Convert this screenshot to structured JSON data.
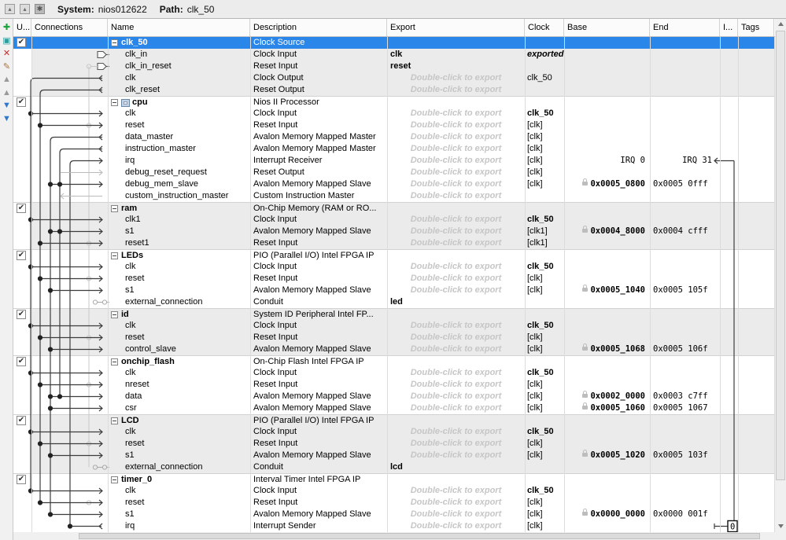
{
  "titlebar": {
    "system_label": "System:",
    "system_value": "nios012622",
    "path_label": "Path:",
    "path_value": "clk_50",
    "icons": [
      {
        "name": "dock-window-icon",
        "glyph": "▴"
      },
      {
        "name": "float-window-icon",
        "glyph": "▴"
      },
      {
        "name": "settings-icon",
        "glyph": "✱"
      }
    ]
  },
  "left_toolbar": {
    "icons": [
      {
        "name": "add-component-icon",
        "glyph": "✚",
        "color": "#1fa33c"
      },
      {
        "name": "duplicate-icon",
        "glyph": "▣",
        "color": "#2e9e9e"
      },
      {
        "name": "remove-icon",
        "glyph": "✕",
        "color": "#cc2a2a"
      },
      {
        "name": "edit-icon",
        "glyph": "✎",
        "color": "#a8763e"
      },
      {
        "name": "move-top-icon",
        "glyph": "▲",
        "color": "#9a9a9a"
      },
      {
        "name": "move-up-icon",
        "glyph": "▲",
        "color": "#9a9a9a"
      },
      {
        "name": "move-down-icon",
        "glyph": "▼",
        "color": "#3277cc"
      },
      {
        "name": "move-bottom-icon",
        "glyph": "▼",
        "color": "#3277cc"
      }
    ]
  },
  "colors": {
    "selection_blue": "#2a86e8",
    "group_shade": "#ebebeb",
    "placeholder_gray": "#c6c6c6",
    "wire_dark": "#3c3c3c",
    "wire_light": "#c8c8c8"
  },
  "table": {
    "columns": [
      {
        "id": "use",
        "label": "U..."
      },
      {
        "id": "connections",
        "label": "Connections"
      },
      {
        "id": "name",
        "label": "Name"
      },
      {
        "id": "description",
        "label": "Description"
      },
      {
        "id": "export",
        "label": "Export"
      },
      {
        "id": "clock",
        "label": "Clock"
      },
      {
        "id": "base",
        "label": "Base"
      },
      {
        "id": "end",
        "label": "End"
      },
      {
        "id": "irq",
        "label": "I..."
      },
      {
        "id": "tags",
        "label": "Tags"
      }
    ],
    "export_placeholder": "Double-click to export",
    "irq_labels": {
      "start": "IRQ 0",
      "end": "IRQ 31",
      "timer_irq_number": "0"
    },
    "rows": [
      {
        "name": "clk_50",
        "desc": "Clock Source",
        "group": true,
        "selected": true,
        "checkbox": true,
        "shade": "g"
      },
      {
        "name": "clk_in",
        "desc": "Clock Input",
        "shade": "g",
        "export": "clk",
        "clock": "exported",
        "clockStyle": "e",
        "conn": {
          "end": "port"
        }
      },
      {
        "name": "clk_in_reset",
        "desc": "Reset Input",
        "shade": "g",
        "export": "reset",
        "conn": {
          "end": "port",
          "lightCircle": true
        }
      },
      {
        "name": "clk",
        "desc": "Clock Output",
        "shade": "g",
        "ph": true,
        "clock": "clk_50",
        "clockStyle": "p",
        "conn": {
          "curve": 1,
          "end": "out"
        }
      },
      {
        "name": "clk_reset",
        "desc": "Reset Output",
        "shade": "g",
        "ph": true,
        "conn": {
          "curve": 2,
          "end": "out"
        }
      },
      {
        "name": "cpu",
        "desc": "Nios II Processor",
        "group": true,
        "checkbox": true,
        "icon": "cpu-chip",
        "shade": "w"
      },
      {
        "name": "clk",
        "desc": "Clock Input",
        "shade": "w",
        "ph": true,
        "clock": "clk_50",
        "clockStyle": "b",
        "conn": {
          "dots": [
            1
          ],
          "end": "in"
        }
      },
      {
        "name": "reset",
        "desc": "Reset Input",
        "shade": "w",
        "ph": true,
        "clock": "[clk]",
        "conn": {
          "dots": [
            2
          ],
          "end": "in",
          "lightCircle": true
        }
      },
      {
        "name": "data_master",
        "desc": "Avalon Memory Mapped Master",
        "shade": "w",
        "ph": true,
        "clock": "[clk]",
        "conn": {
          "curve": 3,
          "end": "out"
        }
      },
      {
        "name": "instruction_master",
        "desc": "Avalon Memory Mapped Master",
        "shade": "w",
        "ph": true,
        "clock": "[clk]",
        "conn": {
          "curve": 4,
          "end": "out"
        }
      },
      {
        "name": "irq",
        "desc": "Interrupt Receiver",
        "shade": "w",
        "ph": true,
        "clock": "[clk]",
        "base": "IRQ 0",
        "end": "IRQ 31",
        "endRight": true,
        "irqArrow": true,
        "conn": {
          "curve": 5,
          "end": "in"
        }
      },
      {
        "name": "debug_reset_request",
        "desc": "Reset Output",
        "shade": "w",
        "ph": true,
        "clock": "[clk]",
        "conn": {
          "end": "gray-in"
        }
      },
      {
        "name": "debug_mem_slave",
        "desc": "Avalon Memory Mapped Slave",
        "shade": "w",
        "ph": true,
        "clock": "[clk]",
        "base": "0x0005_0800",
        "lock": true,
        "end": "0x0005 0fff",
        "conn": {
          "dots": [
            3,
            4
          ],
          "end": "in"
        }
      },
      {
        "name": "custom_instruction_master",
        "desc": "Custom Instruction Master",
        "shade": "w",
        "ph": true,
        "conn": {
          "end": "gray-out"
        }
      },
      {
        "name": "ram",
        "desc": "On-Chip Memory (RAM or RO...",
        "group": true,
        "checkbox": true,
        "shade": "g"
      },
      {
        "name": "clk1",
        "desc": "Clock Input",
        "shade": "g",
        "ph": true,
        "clock": "clk_50",
        "clockStyle": "b",
        "conn": {
          "dots": [
            1
          ],
          "end": "in"
        }
      },
      {
        "name": "s1",
        "desc": "Avalon Memory Mapped Slave",
        "shade": "g",
        "ph": true,
        "clock": "[clk1]",
        "base": "0x0004_8000",
        "lock": true,
        "end": "0x0004 cfff",
        "conn": {
          "dots": [
            3,
            4
          ],
          "end": "in"
        }
      },
      {
        "name": "reset1",
        "desc": "Reset Input",
        "shade": "g",
        "ph": true,
        "clock": "[clk1]",
        "conn": {
          "dots": [
            2
          ],
          "end": "in",
          "lightCircle": true
        }
      },
      {
        "name": "LEDs",
        "desc": "PIO (Parallel I/O) Intel FPGA IP",
        "group": true,
        "checkbox": true,
        "shade": "w"
      },
      {
        "name": "clk",
        "desc": "Clock Input",
        "shade": "w",
        "ph": true,
        "clock": "clk_50",
        "clockStyle": "b",
        "conn": {
          "dots": [
            1
          ],
          "end": "in"
        }
      },
      {
        "name": "reset",
        "desc": "Reset Input",
        "shade": "w",
        "ph": true,
        "clock": "[clk]",
        "conn": {
          "dots": [
            2
          ],
          "end": "in",
          "lightCircle": true
        }
      },
      {
        "name": "s1",
        "desc": "Avalon Memory Mapped Slave",
        "shade": "w",
        "ph": true,
        "clock": "[clk]",
        "base": "0x0005_1040",
        "lock": true,
        "end": "0x0005 105f",
        "conn": {
          "dots": [
            3
          ],
          "end": "in"
        }
      },
      {
        "name": "external_connection",
        "desc": "Conduit",
        "shade": "w",
        "export": "led",
        "conn": {
          "end": "conduit"
        }
      },
      {
        "name": "id",
        "desc": "System ID Peripheral Intel FP...",
        "group": true,
        "checkbox": true,
        "shade": "g"
      },
      {
        "name": "clk",
        "desc": "Clock Input",
        "shade": "g",
        "ph": true,
        "clock": "clk_50",
        "clockStyle": "b",
        "conn": {
          "dots": [
            1
          ],
          "end": "in"
        }
      },
      {
        "name": "reset",
        "desc": "Reset Input",
        "shade": "g",
        "ph": true,
        "clock": "[clk]",
        "conn": {
          "dots": [
            2
          ],
          "end": "in",
          "lightCircle": true
        }
      },
      {
        "name": "control_slave",
        "desc": "Avalon Memory Mapped Slave",
        "shade": "g",
        "ph": true,
        "clock": "[clk]",
        "base": "0x0005_1068",
        "lock": true,
        "end": "0x0005 106f",
        "conn": {
          "dots": [
            3
          ],
          "end": "in"
        }
      },
      {
        "name": "onchip_flash",
        "desc": "On-Chip Flash Intel FPGA IP",
        "group": true,
        "checkbox": true,
        "shade": "w"
      },
      {
        "name": "clk",
        "desc": "Clock Input",
        "shade": "w",
        "ph": true,
        "clock": "clk_50",
        "clockStyle": "b",
        "conn": {
          "dots": [
            1
          ],
          "end": "in"
        }
      },
      {
        "name": "nreset",
        "desc": "Reset Input",
        "shade": "w",
        "ph": true,
        "clock": "[clk]",
        "conn": {
          "dots": [
            2
          ],
          "end": "in",
          "lightCircle": true
        }
      },
      {
        "name": "data",
        "desc": "Avalon Memory Mapped Slave",
        "shade": "w",
        "ph": true,
        "clock": "[clk]",
        "base": "0x0002_0000",
        "lock": true,
        "end": "0x0003 c7ff",
        "conn": {
          "dots": [
            3,
            4
          ],
          "end": "in"
        }
      },
      {
        "name": "csr",
        "desc": "Avalon Memory Mapped Slave",
        "shade": "w",
        "ph": true,
        "clock": "[clk]",
        "base": "0x0005_1060",
        "lock": true,
        "end": "0x0005 1067",
        "conn": {
          "dots": [
            3
          ],
          "end": "in"
        }
      },
      {
        "name": "LCD",
        "desc": "PIO (Parallel I/O) Intel FPGA IP",
        "group": true,
        "checkbox": true,
        "shade": "g"
      },
      {
        "name": "clk",
        "desc": "Clock Input",
        "shade": "g",
        "ph": true,
        "clock": "clk_50",
        "clockStyle": "b",
        "conn": {
          "dots": [
            1
          ],
          "end": "in"
        }
      },
      {
        "name": "reset",
        "desc": "Reset Input",
        "shade": "g",
        "ph": true,
        "clock": "[clk]",
        "conn": {
          "dots": [
            2
          ],
          "end": "in",
          "lightCircle": true
        }
      },
      {
        "name": "s1",
        "desc": "Avalon Memory Mapped Slave",
        "shade": "g",
        "ph": true,
        "clock": "[clk]",
        "base": "0x0005_1020",
        "lock": true,
        "end": "0x0005 103f",
        "conn": {
          "dots": [
            3
          ],
          "end": "in"
        }
      },
      {
        "name": "external_connection",
        "desc": "Conduit",
        "shade": "g",
        "export": "lcd",
        "conn": {
          "end": "conduit"
        }
      },
      {
        "name": "timer_0",
        "desc": "Interval Timer Intel FPGA IP",
        "group": true,
        "checkbox": true,
        "shade": "w"
      },
      {
        "name": "clk",
        "desc": "Clock Input",
        "shade": "w",
        "ph": true,
        "clock": "clk_50",
        "clockStyle": "b",
        "conn": {
          "dots": [
            1
          ],
          "end": "in"
        }
      },
      {
        "name": "reset",
        "desc": "Reset Input",
        "shade": "w",
        "ph": true,
        "clock": "[clk]",
        "conn": {
          "dots": [
            2
          ],
          "end": "in",
          "lightCircle": true
        }
      },
      {
        "name": "s1",
        "desc": "Avalon Memory Mapped Slave",
        "shade": "w",
        "ph": true,
        "clock": "[clk]",
        "base": "0x0000_0000",
        "lock": true,
        "end": "0x0000 001f",
        "conn": {
          "dots": [
            3
          ],
          "end": "in"
        }
      },
      {
        "name": "irq",
        "desc": "Interrupt Sender",
        "shade": "w",
        "ph": true,
        "clock": "[clk]",
        "irqBox": true,
        "conn": {
          "dots": [
            5
          ],
          "end": "out"
        }
      }
    ]
  }
}
